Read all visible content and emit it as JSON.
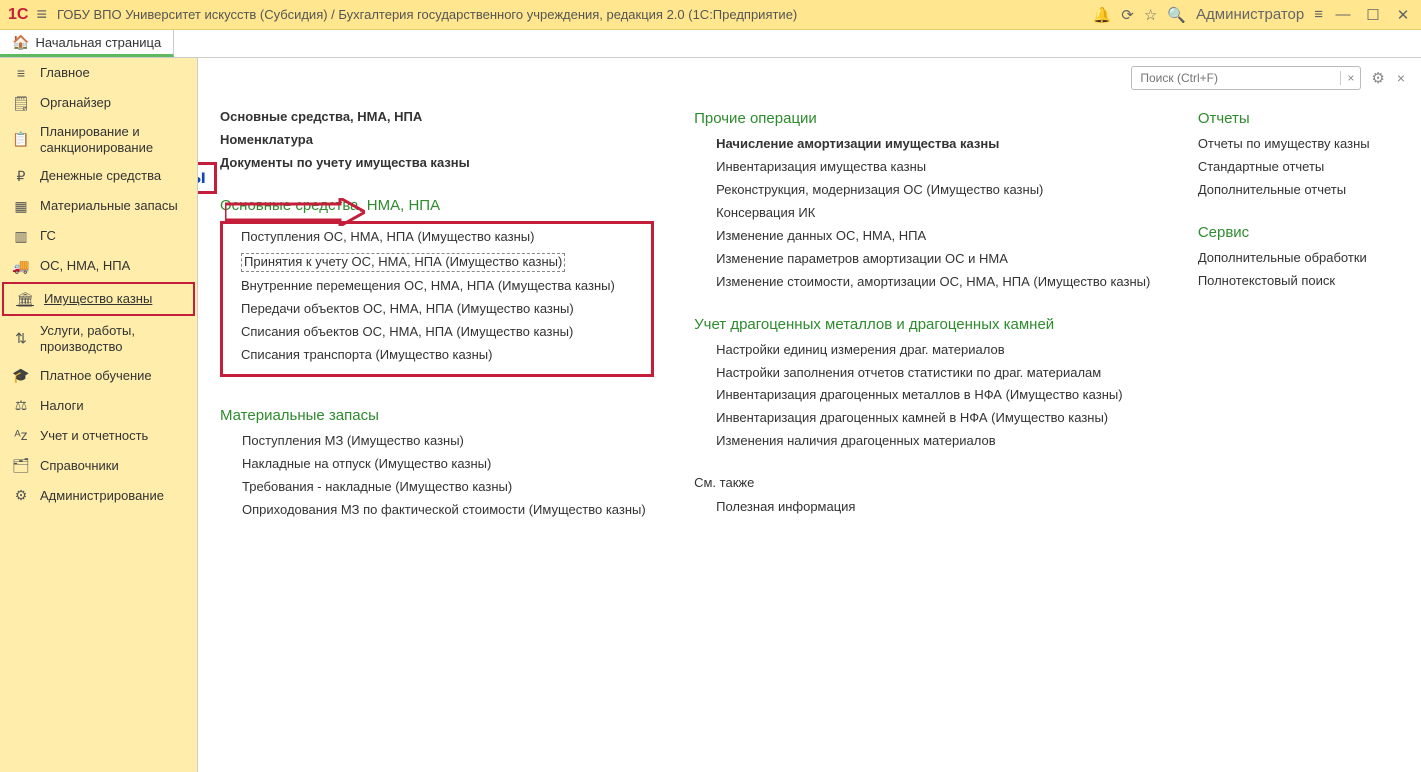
{
  "title": "ГОБУ ВПО Университет искусств (Субсидия) / Бухгалтерия государственного учреждения, редакция 2.0  (1С:Предприятие)",
  "user": "Администратор",
  "home_tab": "Начальная страница",
  "search_placeholder": "Поиск (Ctrl+F)",
  "sidebar": [
    {
      "label": "Главное",
      "icon": "≡"
    },
    {
      "label": "Органайзер",
      "icon": "🗒"
    },
    {
      "label": "Планирование и санкционирование",
      "icon": "📋"
    },
    {
      "label": "Денежные средства",
      "icon": "₽"
    },
    {
      "label": "Материальные запасы",
      "icon": "▦"
    },
    {
      "label": "ГС",
      "icon": "▥"
    },
    {
      "label": "ОС, НМА, НПА",
      "icon": "🚚"
    },
    {
      "label": "Имущество казны",
      "icon": "🏛"
    },
    {
      "label": "Услуги, работы, производство",
      "icon": "⇅"
    },
    {
      "label": "Платное обучение",
      "icon": "🎓"
    },
    {
      "label": "Налоги",
      "icon": "⚖"
    },
    {
      "label": "Учет и отчетность",
      "icon": "ᴬz"
    },
    {
      "label": "Справочники",
      "icon": "🗂"
    },
    {
      "label": "Администрирование",
      "icon": "⚙"
    }
  ],
  "doc_label": "Документы",
  "col1": {
    "top_bold": [
      "Основные средства, НМА, НПА",
      "Номенклатура",
      "Документы по учету имущества казны"
    ],
    "sec2_head": "Основные средства, НМА, НПА",
    "sec2_links": [
      "Поступления ОС, НМА, НПА (Имущество казны)",
      "Принятия к учету ОС, НМА, НПА (Имущество казны)",
      "Внутренние перемещения ОС, НМА, НПА (Имущества казны)",
      "Передачи объектов ОС, НМА, НПА (Имущество казны)",
      "Списания объектов ОС, НМА, НПА (Имущество казны)",
      "Списания транспорта (Имущество казны)"
    ],
    "sec3_head": "Материальные запасы",
    "sec3_links": [
      "Поступления МЗ (Имущество казны)",
      "Накладные на отпуск (Имущество казны)",
      "Требования - накладные (Имущество казны)",
      "Оприходования МЗ по фактической стоимости (Имущество казны)"
    ]
  },
  "col2": {
    "sec1_head": "Прочие операции",
    "sec1_links": [
      "Начисление амортизации имущества казны",
      "Инвентаризация имущества казны",
      "Реконструкция, модернизация ОС (Имущество казны)",
      "Консервация ИК",
      "Изменение данных ОС, НМА, НПА",
      "Изменение параметров амортизации ОС и НМА",
      "Изменение стоимости, амортизации ОС, НМА, НПА (Имущество казны)"
    ],
    "sec2_head": "Учет драгоценных металлов и драгоценных камней",
    "sec2_links": [
      "Настройки единиц измерения драг. материалов",
      "Настройки заполнения отчетов статистики по драг. материалам",
      "Инвентаризация драгоценных металлов в НФА (Имущество казны)",
      "Инвентаризация драгоценных камней в НФА (Имущество казны)",
      "Изменения наличия драгоценных материалов"
    ],
    "see_also": "См. также",
    "see_also_links": [
      "Полезная информация"
    ]
  },
  "col3": {
    "sec1_head": "Отчеты",
    "sec1_links": [
      "Отчеты по имуществу казны",
      "Стандартные отчеты",
      "Дополнительные отчеты"
    ],
    "sec2_head": "Сервис",
    "sec2_links": [
      "Дополнительные обработки",
      "Полнотекстовый поиск"
    ]
  }
}
